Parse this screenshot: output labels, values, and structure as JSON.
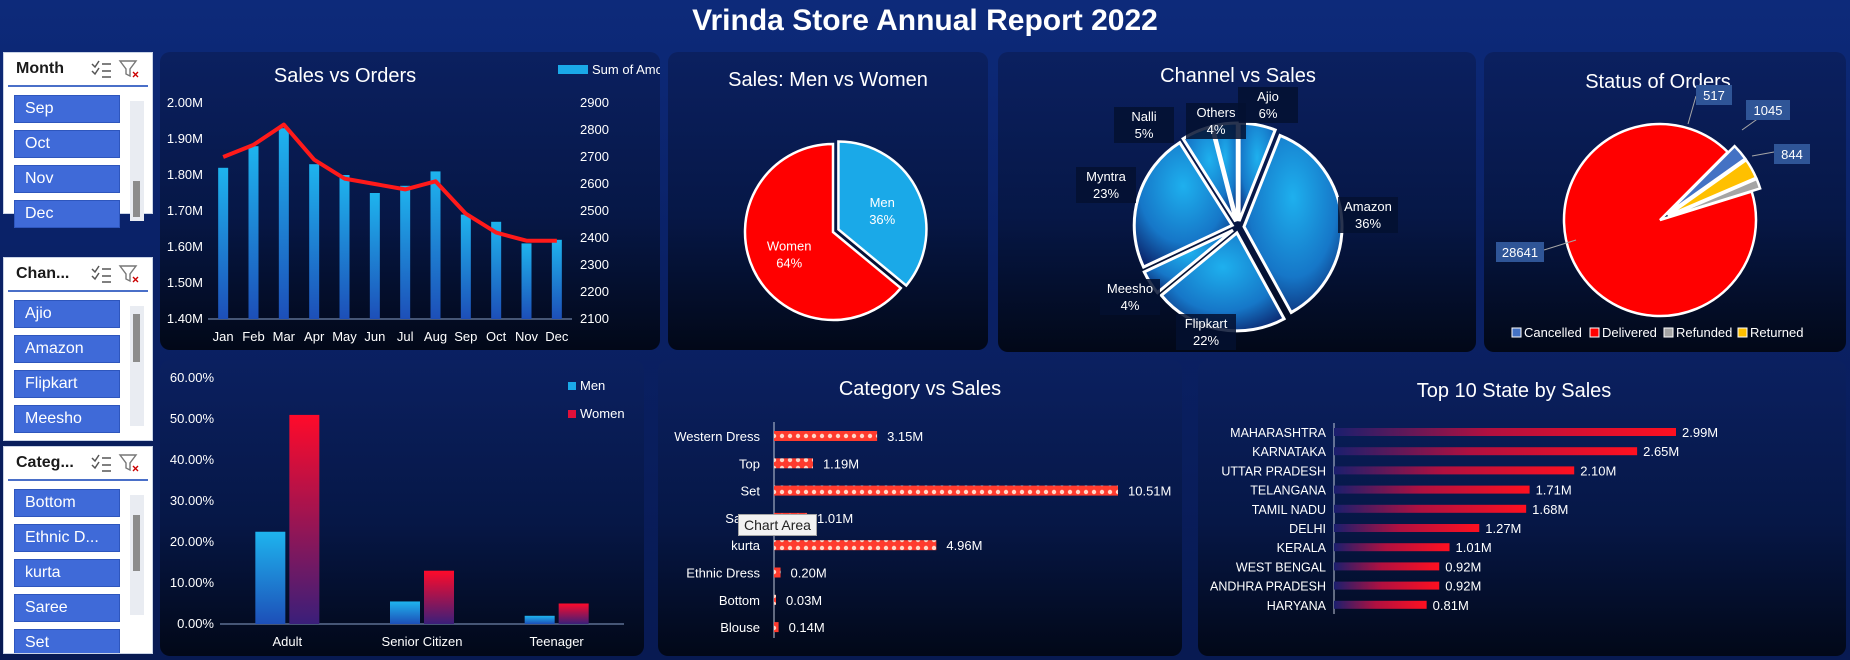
{
  "title": "Vrinda Store Annual Report 2022",
  "tooltip": "Chart Area",
  "slicers": [
    {
      "title": "Month",
      "items": [
        "Sep",
        "Oct",
        "Nov",
        "Dec"
      ]
    },
    {
      "title": "Chan...",
      "items": [
        "Ajio",
        "Amazon",
        "Flipkart",
        "Meesho"
      ]
    },
    {
      "title": "Categ...",
      "items": [
        "Bottom",
        "Ethnic D...",
        "kurta",
        "Saree",
        "Set"
      ]
    }
  ],
  "colors": {
    "accent_blue": "#1aa9e8",
    "accent_red": "#ff0000",
    "slicer_item": "#3f6ad8"
  },
  "chart_data": [
    {
      "id": "sales-vs-orders",
      "type": "bar",
      "title": "Sales vs Orders",
      "legend": "Sum of Amount",
      "categories": [
        "Jan",
        "Feb",
        "Mar",
        "Apr",
        "May",
        "Jun",
        "Jul",
        "Aug",
        "Sep",
        "Oct",
        "Nov",
        "Dec"
      ],
      "series": [
        {
          "name": "Sum of Amount",
          "axis": "left",
          "values": [
            1.82,
            1.88,
            1.93,
            1.83,
            1.8,
            1.75,
            1.77,
            1.81,
            1.69,
            1.67,
            1.61,
            1.62
          ]
        },
        {
          "axis": "right",
          "type": "line",
          "values": [
            2700,
            2745,
            2820,
            2690,
            2620,
            2600,
            2580,
            2610,
            2490,
            2420,
            2390,
            2390
          ]
        }
      ],
      "y_left_ticks": [
        "1.40M",
        "1.50M",
        "1.60M",
        "1.70M",
        "1.80M",
        "1.90M",
        "2.00M"
      ],
      "y_left_range": [
        1.4,
        2.0
      ],
      "y_right_ticks": [
        "2100",
        "2200",
        "2300",
        "2400",
        "2500",
        "2600",
        "2700",
        "2800",
        "2900"
      ],
      "y_right_range": [
        2100,
        2900
      ]
    },
    {
      "id": "men-vs-women",
      "type": "pie",
      "title": "Sales: Men vs Women",
      "slices": [
        {
          "name": "Men",
          "label": "36%",
          "value": 36,
          "color": "#1aa9e8"
        },
        {
          "name": "Women",
          "label": "64%",
          "value": 64,
          "color": "#ff0000"
        }
      ]
    },
    {
      "id": "channel-vs-sales",
      "type": "pie",
      "title": "Channel vs Sales",
      "slices": [
        {
          "name": "Ajio",
          "label": "6%",
          "value": 6
        },
        {
          "name": "Amazon",
          "label": "36%",
          "value": 36
        },
        {
          "name": "Flipkart",
          "label": "22%",
          "value": 22
        },
        {
          "name": "Meesho",
          "label": "4%",
          "value": 4
        },
        {
          "name": "Myntra",
          "label": "23%",
          "value": 23
        },
        {
          "name": "Nalli",
          "label": "5%",
          "value": 5
        },
        {
          "name": "Others",
          "label": "4%",
          "value": 4
        }
      ]
    },
    {
      "id": "status-of-orders",
      "type": "pie",
      "title": "Status of Orders",
      "slices": [
        {
          "name": "Delivered",
          "label": "28641",
          "value": 28641,
          "color": "#ff0000"
        },
        {
          "name": "Cancelled",
          "label": "844",
          "value": 844,
          "color": "#4472c4"
        },
        {
          "name": "Returned",
          "label": "1045",
          "value": 1045,
          "color": "#ffc000"
        },
        {
          "name": "Refunded",
          "label": "517",
          "value": 517,
          "color": "#a5a5a5"
        }
      ],
      "legend": [
        "Cancelled",
        "Delivered",
        "Refunded",
        "Returned"
      ]
    },
    {
      "id": "age-gender",
      "type": "bar",
      "categories": [
        "Adult",
        "Senior Citizen",
        "Teenager"
      ],
      "series": [
        {
          "name": "Men",
          "values": [
            22.5,
            5.5,
            2.0
          ]
        },
        {
          "name": "Women",
          "values": [
            51,
            13,
            5
          ]
        }
      ],
      "y_ticks": [
        "0.00%",
        "10.00%",
        "20.00%",
        "30.00%",
        "40.00%",
        "50.00%",
        "60.00%"
      ],
      "ylim": [
        0,
        60
      ]
    },
    {
      "id": "category-vs-sales",
      "type": "bar",
      "orientation": "horizontal",
      "title": "Category vs Sales",
      "categories": [
        "Western Dress",
        "Top",
        "Set",
        "Saree",
        "kurta",
        "Ethnic Dress",
        "Bottom",
        "Blouse"
      ],
      "values": [
        3.15,
        1.19,
        10.51,
        1.01,
        4.96,
        0.2,
        0.03,
        0.14
      ],
      "labels": [
        "3.15M",
        "1.19M",
        "10.51M",
        "1.01M",
        "4.96M",
        "0.20M",
        "0.03M",
        "0.14M"
      ]
    },
    {
      "id": "top-states",
      "type": "bar",
      "orientation": "horizontal",
      "title": "Top 10 State by Sales",
      "categories": [
        "MAHARASHTRA",
        "KARNATAKA",
        "UTTAR PRADESH",
        "TELANGANA",
        "TAMIL NADU",
        "DELHI",
        "KERALA",
        "WEST BENGAL",
        "ANDHRA PRADESH",
        "HARYANA"
      ],
      "values": [
        2.99,
        2.65,
        2.1,
        1.71,
        1.68,
        1.27,
        1.01,
        0.92,
        0.92,
        0.81
      ],
      "labels": [
        "2.99M",
        "2.65M",
        "2.10M",
        "1.71M",
        "1.68M",
        "1.27M",
        "1.01M",
        "0.92M",
        "0.92M",
        "0.81M"
      ]
    }
  ]
}
